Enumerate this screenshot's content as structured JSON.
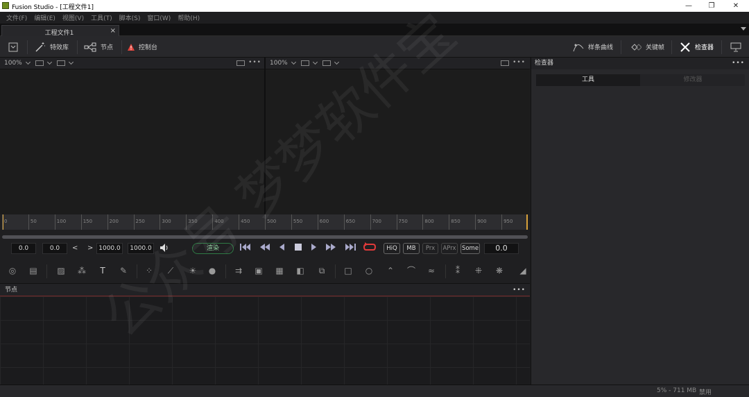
{
  "window": {
    "title": "Fusion Studio - [工程文件1]",
    "minimize": "—",
    "maximize": "❐",
    "close": "✕"
  },
  "menu": [
    "文件(F)",
    "编辑(E)",
    "视图(V)",
    "工具(T)",
    "脚本(S)",
    "窗口(W)",
    "帮助(H)"
  ],
  "tabs": {
    "doc_tab": "工程文件1",
    "close": "×"
  },
  "toolbar": {
    "effects": "特效库",
    "nodes": "节点",
    "console": "控制台",
    "spline": "样条曲线",
    "keyframes": "关键帧",
    "inspector": "检查器"
  },
  "viewer_left": {
    "zoom": "100%",
    "more": "•••"
  },
  "viewer_right": {
    "zoom": "100%",
    "more": "•••"
  },
  "timeline": {
    "ticks": [
      "0",
      "50",
      "100",
      "150",
      "200",
      "250",
      "300",
      "350",
      "400",
      "450",
      "500",
      "550",
      "600",
      "650",
      "700",
      "750",
      "800",
      "850",
      "900",
      "950"
    ],
    "max_frame": 1000
  },
  "transport": {
    "global_start": "0.0",
    "render_start": "0.0",
    "prev": "<",
    "next": ">",
    "render_end": "1000.0",
    "global_end": "1000.0",
    "render_button": "渲染",
    "quality_buttons": [
      "HiQ",
      "MB",
      "Prx",
      "APrx",
      "Some"
    ],
    "current_time": "0.0"
  },
  "nodes_panel": {
    "title": "节点",
    "more": "•••"
  },
  "inspector": {
    "title": "检查器",
    "more": "•••",
    "tab_tools": "工具",
    "tab_modifiers": "修改器"
  },
  "status": {
    "memory": "5% - 711 MB",
    "state": "禁用"
  },
  "watermark": "公众号 梦梦软件宝"
}
